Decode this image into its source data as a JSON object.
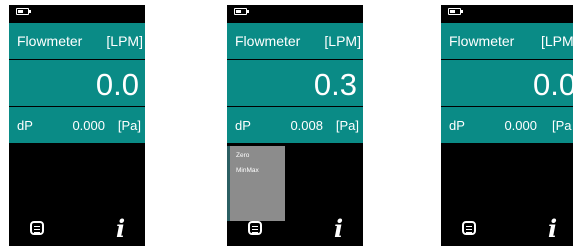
{
  "screens": [
    {
      "header": {
        "title": "Flowmeter",
        "unit": "[LPM]"
      },
      "flow_value": "0.0",
      "dp": {
        "label": "dP",
        "value": "0.000",
        "unit": "[Pa]"
      },
      "menu_open": false,
      "menu_items": []
    },
    {
      "header": {
        "title": "Flowmeter",
        "unit": "[LPM]"
      },
      "flow_value": "0.3",
      "dp": {
        "label": "dP",
        "value": "0.008",
        "unit": "[Pa]"
      },
      "menu_open": true,
      "menu_items": [
        "Zero",
        "MinMax"
      ]
    },
    {
      "header": {
        "title": "Flowmeter",
        "unit": "[LPM"
      },
      "flow_value": "0.0",
      "dp": {
        "label": "dP",
        "value": "0.000",
        "unit": "[Pa"
      },
      "menu_open": false,
      "menu_items": []
    }
  ],
  "battery": {
    "level": 0.6
  },
  "icons": {
    "menu": "menu-icon",
    "info": "info-icon"
  },
  "info_glyph": "i",
  "colors": {
    "panel": "#0a8b86",
    "background": "#000000",
    "menu_popup": "#8c8c8c",
    "text": "#ffffff"
  }
}
